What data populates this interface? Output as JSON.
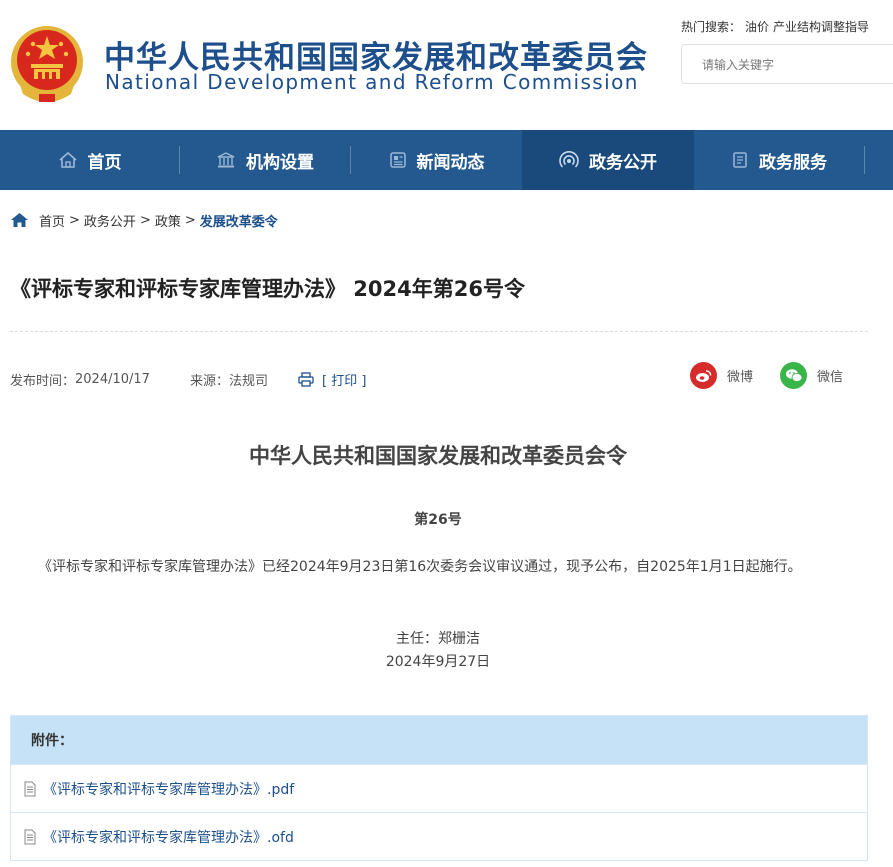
{
  "header": {
    "title_cn": "中华人民共和国国家发展和改革委员会",
    "title_en": "National Development and Reform Commission",
    "hot_label": "热门搜索：",
    "hot_items": [
      "油价",
      "产业结构调整指导"
    ],
    "search_placeholder": "请输入关键字"
  },
  "nav": {
    "items": [
      {
        "label": "首页",
        "icon": "home-icon"
      },
      {
        "label": "机构设置",
        "icon": "building-icon"
      },
      {
        "label": "新闻动态",
        "icon": "news-icon"
      },
      {
        "label": "政务公开",
        "icon": "signal-icon",
        "active": true
      },
      {
        "label": "政务服务",
        "icon": "document-icon"
      }
    ]
  },
  "breadcrumb": {
    "items": [
      "首页",
      "政务公开",
      "政策"
    ],
    "current": "发展改革委令",
    "separator": ">"
  },
  "article": {
    "title": "《评标专家和评标专家库管理办法》 2024年第26号令",
    "publish_label": "发布时间：",
    "publish_date": "2024/10/17",
    "source_label": "来源：",
    "source": "法规司",
    "print_label": "[ 打印 ]",
    "share_weibo": "微博",
    "share_wechat": "微信"
  },
  "document": {
    "heading": "中华人民共和国国家发展和改革委员会令",
    "number": "第26号",
    "paragraph": "《评标专家和评标专家库管理办法》已经2024年9月23日第16次委务会议审议通过，现予公布，自2025年1月1日起施行。",
    "signer": "主任：郑栅洁",
    "date": "2024年9月27日"
  },
  "attachments": {
    "label": "附件：",
    "files": [
      "《评标专家和评标专家库管理办法》.pdf",
      "《评标专家和评标专家库管理办法》.ofd"
    ]
  },
  "colors": {
    "brand": "#1c4f8c",
    "nav_bg": "#23598f",
    "nav_active": "#194a7b",
    "weibo": "#d52c2b",
    "wechat": "#39b54a",
    "attach_head": "#c6e2f6"
  }
}
